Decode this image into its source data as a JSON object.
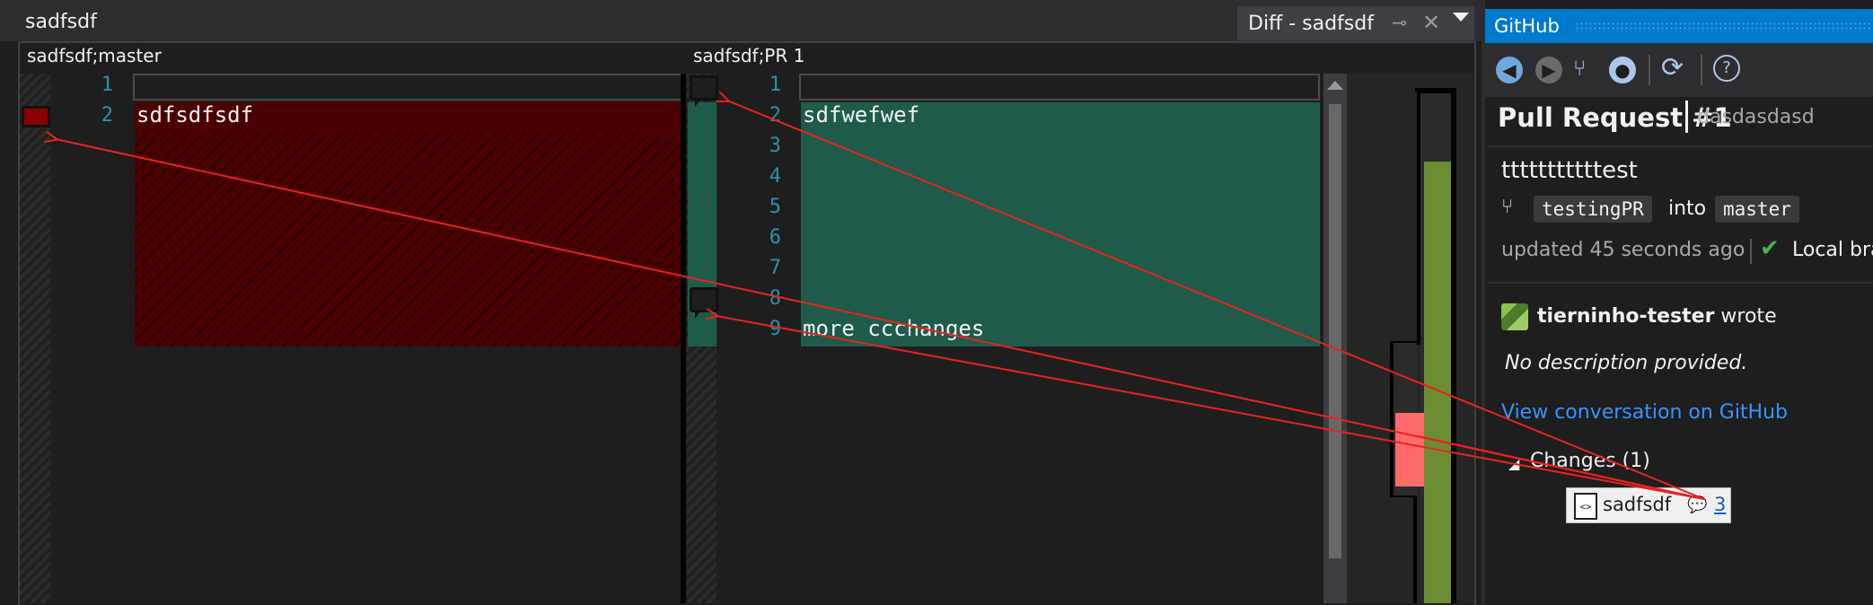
{
  "window": {
    "document_title": "sadfsdf"
  },
  "tab": {
    "label": "Diff - sadfsdf",
    "pin_icon": "pin-icon",
    "close_icon": "close-icon",
    "dropdown_icon": "chevron-down-icon"
  },
  "left_pane": {
    "header": "sadfsdf;master",
    "lines": [
      {
        "number": "1",
        "text": "",
        "type": "empty"
      },
      {
        "number": "2",
        "text": "sdfsdfsdf",
        "type": "removed"
      }
    ]
  },
  "right_pane": {
    "header": "sadfsdf;PR 1",
    "lines": [
      {
        "number": "1",
        "text": "",
        "type": "empty"
      },
      {
        "number": "2",
        "text": "sdfwefwef",
        "type": "added"
      },
      {
        "number": "3",
        "text": "",
        "type": "added"
      },
      {
        "number": "4",
        "text": "",
        "type": "added"
      },
      {
        "number": "5",
        "text": "",
        "type": "added"
      },
      {
        "number": "6",
        "text": "",
        "type": "added"
      },
      {
        "number": "7",
        "text": "",
        "type": "added"
      },
      {
        "number": "8",
        "text": "",
        "type": "added"
      },
      {
        "number": "9",
        "text": "more ccchanges",
        "type": "added"
      }
    ]
  },
  "github": {
    "header_title": "GitHub",
    "toolbar": [
      "back-icon",
      "forward-icon",
      "pull-request-icon",
      "github-icon",
      "refresh-icon",
      "help-icon"
    ],
    "pr_title": "Pull Request #1",
    "pr_repo": "dasdasdasd",
    "pr_name": "tttttttttttest",
    "source_branch": "testingPR",
    "into": "into",
    "target_branch": "master",
    "updated": "updated 45 seconds ago",
    "local_branch": "Local bra",
    "author": "tierninho-tester",
    "wrote": "wrote",
    "description": "No description provided.",
    "view_link": "View conversation on GitHub",
    "changes_label": "Changes (1)",
    "file": {
      "name": "sadfsdf",
      "comment_count": "3",
      "icon": "code-file-icon",
      "comment_icon": "comment-icon"
    }
  },
  "colors": {
    "removed": "#4b0000",
    "added": "#1e5b4b",
    "line_number": "#2b91af",
    "accent": "#007acc",
    "link": "#3794ff",
    "annotation_arrow": "#e8231f"
  }
}
